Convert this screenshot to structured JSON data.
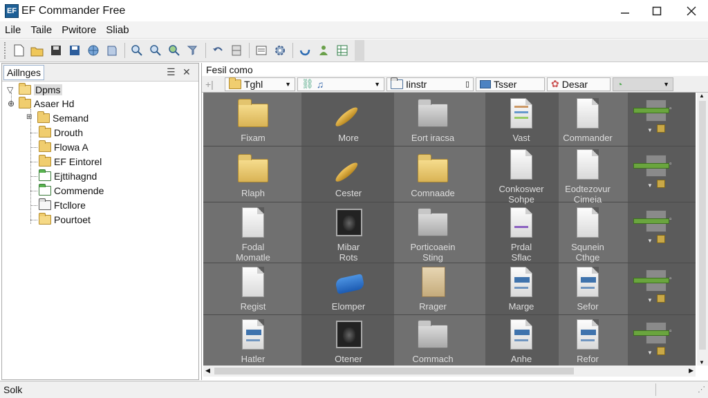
{
  "window": {
    "title": "EF Commander Free",
    "app_icon": "EF",
    "minimize": "—",
    "maximize": "☐",
    "close": "✕"
  },
  "menu": [
    "Lile",
    "Taile",
    "Pwitore",
    "Sliab"
  ],
  "left_pane": {
    "tab_label": "Aillnges",
    "tree": [
      {
        "label": "Dpms",
        "selected": true
      },
      {
        "label": "Asaer Hd"
      },
      {
        "label": "Semand"
      },
      {
        "label": "Drouth"
      },
      {
        "label": "Flowa A"
      },
      {
        "label": "EF Eintorel"
      },
      {
        "label": "Ejttihagnd"
      },
      {
        "label": "Commende"
      },
      {
        "label": "Ftcllore"
      },
      {
        "label": "Pourtoet"
      }
    ]
  },
  "right_pane": {
    "path": "Fesil como",
    "filters": {
      "drive": "Tghl",
      "type_icon": "♫",
      "folder": "Iinstr",
      "tasks": "Tsser",
      "desar": "Desar"
    },
    "items": [
      [
        {
          "label": "Fixam",
          "icon": "folder-yellow"
        },
        {
          "label": "More",
          "icon": "horn"
        },
        {
          "label": "Eort iracsa",
          "icon": "folder-gray"
        },
        {
          "label": "Vast",
          "icon": "document"
        },
        {
          "label": "Commander",
          "icon": "document"
        }
      ],
      [
        {
          "label": "Rlaph",
          "icon": "folder-yellow"
        },
        {
          "label": "Cester",
          "icon": "horn"
        },
        {
          "label": "Comnaade",
          "icon": "folder-yellow"
        },
        {
          "label": "Conkoswer\nSohpe",
          "icon": "document"
        },
        {
          "label": "Eodtezovur\nCimeia",
          "icon": "document"
        }
      ],
      [
        {
          "label": "Fodal\nMomatle",
          "icon": "document"
        },
        {
          "label": "Mibar\nRots",
          "icon": "photo"
        },
        {
          "label": "Porticoaein\nSting",
          "icon": "folder-gray"
        },
        {
          "label": "Prdal\nSflac",
          "icon": "document"
        },
        {
          "label": "Squnein\nCthge",
          "icon": "document"
        }
      ],
      [
        {
          "label": "Regist",
          "icon": "document"
        },
        {
          "label": "Elomper",
          "icon": "blue-object"
        },
        {
          "label": "Rrager",
          "icon": "paper"
        },
        {
          "label": "Marge",
          "icon": "document-blue"
        },
        {
          "label": "Sefor",
          "icon": "document-blue"
        }
      ],
      [
        {
          "label": "Hatler",
          "icon": "document-blue"
        },
        {
          "label": "Otener",
          "icon": "photo"
        },
        {
          "label": "Commach",
          "icon": "folder-gray"
        },
        {
          "label": "Anhe",
          "icon": "document-blue"
        },
        {
          "label": "Refor",
          "icon": "document-blue"
        }
      ]
    ]
  },
  "status": {
    "text": "Solk"
  },
  "icons": [
    "new-icon",
    "open-folder-icon",
    "save-icon",
    "save-all-icon",
    "globe-icon",
    "bookmark-icon",
    "zoom-icon",
    "zoom-out-icon",
    "zoom-in-icon",
    "filter-icon",
    "undo-icon",
    "split-icon",
    "list-icon",
    "settings-icon",
    "sync-icon",
    "user-icon",
    "grid-icon"
  ]
}
